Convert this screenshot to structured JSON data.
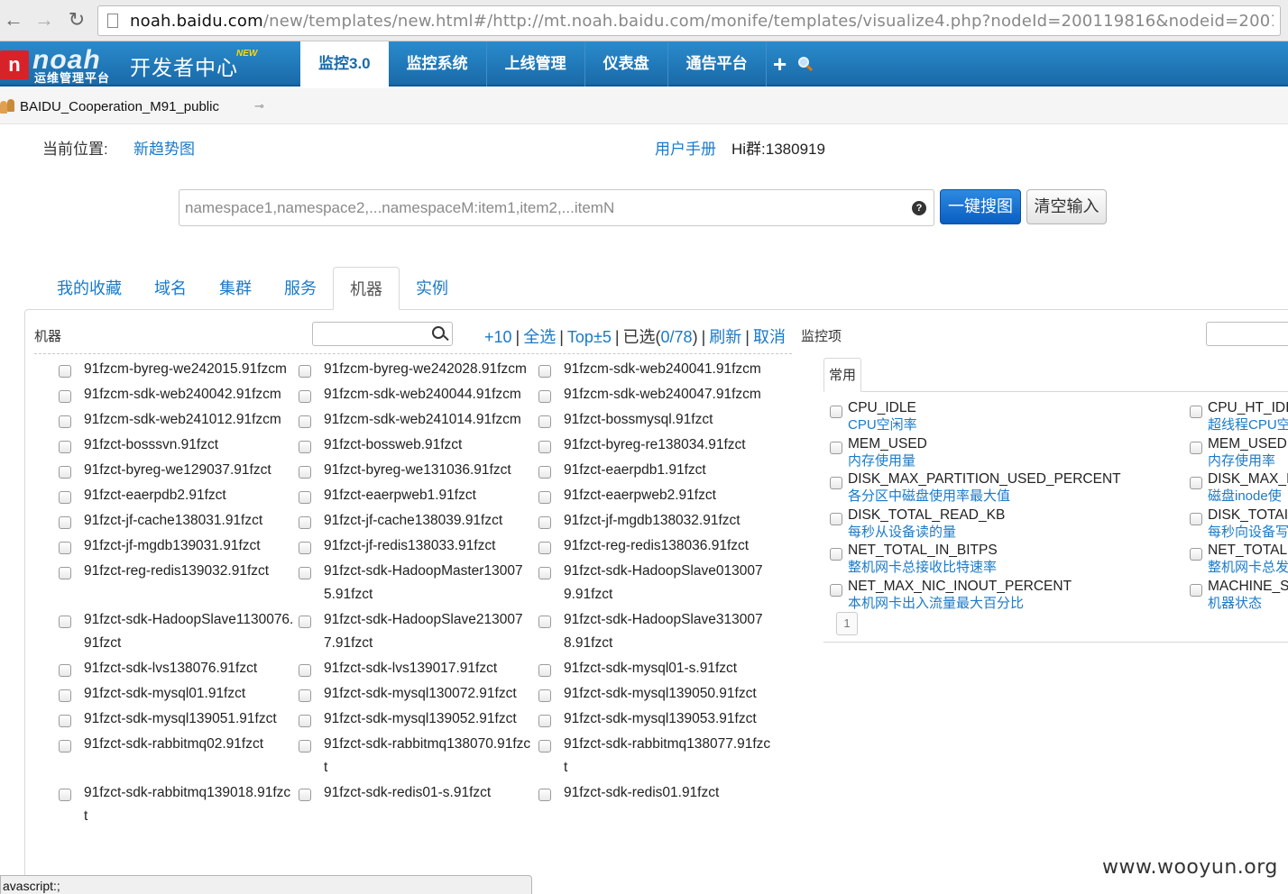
{
  "browser": {
    "url_host": "noah.baidu.com",
    "url_rest": "/new/templates/new.html#/http://mt.noah.baidu.com/monife/templates/visualize4.php?nodeId=200119816&nodeid=20011..."
  },
  "header": {
    "logo_text": "noah",
    "logo_sub": "运维管理平台",
    "dev_center": "开发者中心",
    "new_badge": "NEW",
    "tabs": [
      "监控3.0",
      "监控系统",
      "上线管理",
      "仪表盘",
      "通告平台"
    ],
    "plus": "+",
    "colors": {
      "bar": "#1a6aa8",
      "active_tab_text": "#1a6aa8"
    }
  },
  "subbar": {
    "user": "BAIDU_Cooperation_M91_public"
  },
  "breadcrumb": {
    "label": "当前位置:",
    "current": "新趋势图",
    "manual": "用户手册",
    "hi_group": "Hi群:1380919"
  },
  "search": {
    "placeholder": "namespace1,namespace2,...namespaceM:item1,item2,...itemN",
    "help": "?",
    "search_button": "一键搜图",
    "clear_button": "清空输入"
  },
  "tabs": [
    "我的收藏",
    "域名",
    "集群",
    "服务",
    "机器",
    "实例"
  ],
  "machine_panel": {
    "title": "机器",
    "toolbar": {
      "plus10": "+10",
      "select_all": "全选",
      "top5": "Top±5",
      "selected_prefix": "已选(",
      "selected_count": "0/78",
      "selected_suffix": ")",
      "refresh": "刷新",
      "cancel": "取消"
    },
    "rows": [
      [
        "91fzcm-byreg-we242015.91fzcm",
        "91fzcm-byreg-we242028.91fzcm",
        "91fzcm-sdk-web240041.91fzcm"
      ],
      [
        "91fzcm-sdk-web240042.91fzcm",
        "91fzcm-sdk-web240044.91fzcm",
        "91fzcm-sdk-web240047.91fzcm"
      ],
      [
        "91fzcm-sdk-web241012.91fzcm",
        "91fzcm-sdk-web241014.91fzcm",
        "91fzct-bossmysql.91fzct"
      ],
      [
        "91fzct-bosssvn.91fzct",
        "91fzct-bossweb.91fzct",
        "91fzct-byreg-re138034.91fzct"
      ],
      [
        "91fzct-byreg-we129037.91fzct",
        "91fzct-byreg-we131036.91fzct",
        "91fzct-eaerpdb1.91fzct"
      ],
      [
        "91fzct-eaerpdb2.91fzct",
        "91fzct-eaerpweb1.91fzct",
        "91fzct-eaerpweb2.91fzct"
      ],
      [
        "91fzct-jf-cache138031.91fzct",
        "91fzct-jf-cache138039.91fzct",
        "91fzct-jf-mgdb138032.91fzct"
      ],
      [
        "91fzct-jf-mgdb139031.91fzct",
        "91fzct-jf-redis138033.91fzct",
        "91fzct-reg-redis138036.91fzct"
      ],
      [
        "91fzct-reg-redis139032.91fzct",
        "91fzct-sdk-HadoopMaster130075.91fzct",
        "91fzct-sdk-HadoopSlave0130079.91fzct"
      ],
      [
        "91fzct-sdk-HadoopSlave1130076.91fzct",
        "91fzct-sdk-HadoopSlave2130077.91fzct",
        "91fzct-sdk-HadoopSlave3130078.91fzct"
      ],
      [
        "91fzct-sdk-lvs138076.91fzct",
        "91fzct-sdk-lvs139017.91fzct",
        "91fzct-sdk-mysql01-s.91fzct"
      ],
      [
        "91fzct-sdk-mysql01.91fzct",
        "91fzct-sdk-mysql130072.91fzct",
        "91fzct-sdk-mysql139050.91fzct"
      ],
      [
        "91fzct-sdk-mysql139051.91fzct",
        "91fzct-sdk-mysql139052.91fzct",
        "91fzct-sdk-mysql139053.91fzct"
      ],
      [
        "91fzct-sdk-rabbitmq02.91fzct",
        "91fzct-sdk-rabbitmq138070.91fzct",
        "91fzct-sdk-rabbitmq138077.91fzct"
      ],
      [
        "91fzct-sdk-rabbitmq139018.91fzct",
        "91fzct-sdk-redis01-s.91fzct",
        "91fzct-sdk-redis01.91fzct"
      ]
    ]
  },
  "monitor_panel": {
    "title": "监控项",
    "tab": "常用",
    "items_left": [
      {
        "name": "CPU_IDLE",
        "desc": "CPU空闲率"
      },
      {
        "name": "MEM_USED",
        "desc": "内存使用量"
      },
      {
        "name": "DISK_MAX_PARTITION_USED_PERCENT",
        "desc": "各分区中磁盘使用率最大值"
      },
      {
        "name": "DISK_TOTAL_READ_KB",
        "desc": "每秒从设备读的量"
      },
      {
        "name": "NET_TOTAL_IN_BITPS",
        "desc": "整机网卡总接收比特速率"
      },
      {
        "name": "NET_MAX_NIC_INOUT_PERCENT",
        "desc": "本机网卡出入流量最大百分比"
      }
    ],
    "items_right": [
      {
        "name": "CPU_HT_IDI",
        "desc": "超线程CPU空"
      },
      {
        "name": "MEM_USED",
        "desc": "内存使用率"
      },
      {
        "name": "DISK_MAX_I",
        "desc": "磁盘inode使"
      },
      {
        "name": "DISK_TOTAI",
        "desc": "每秒向设备写"
      },
      {
        "name": "NET_TOTAL",
        "desc": "整机网卡总发"
      },
      {
        "name": "MACHINE_S",
        "desc": "机器状态"
      }
    ],
    "page": "1"
  },
  "status_bar": "avascript:;",
  "watermark": "www.wooyun.org"
}
